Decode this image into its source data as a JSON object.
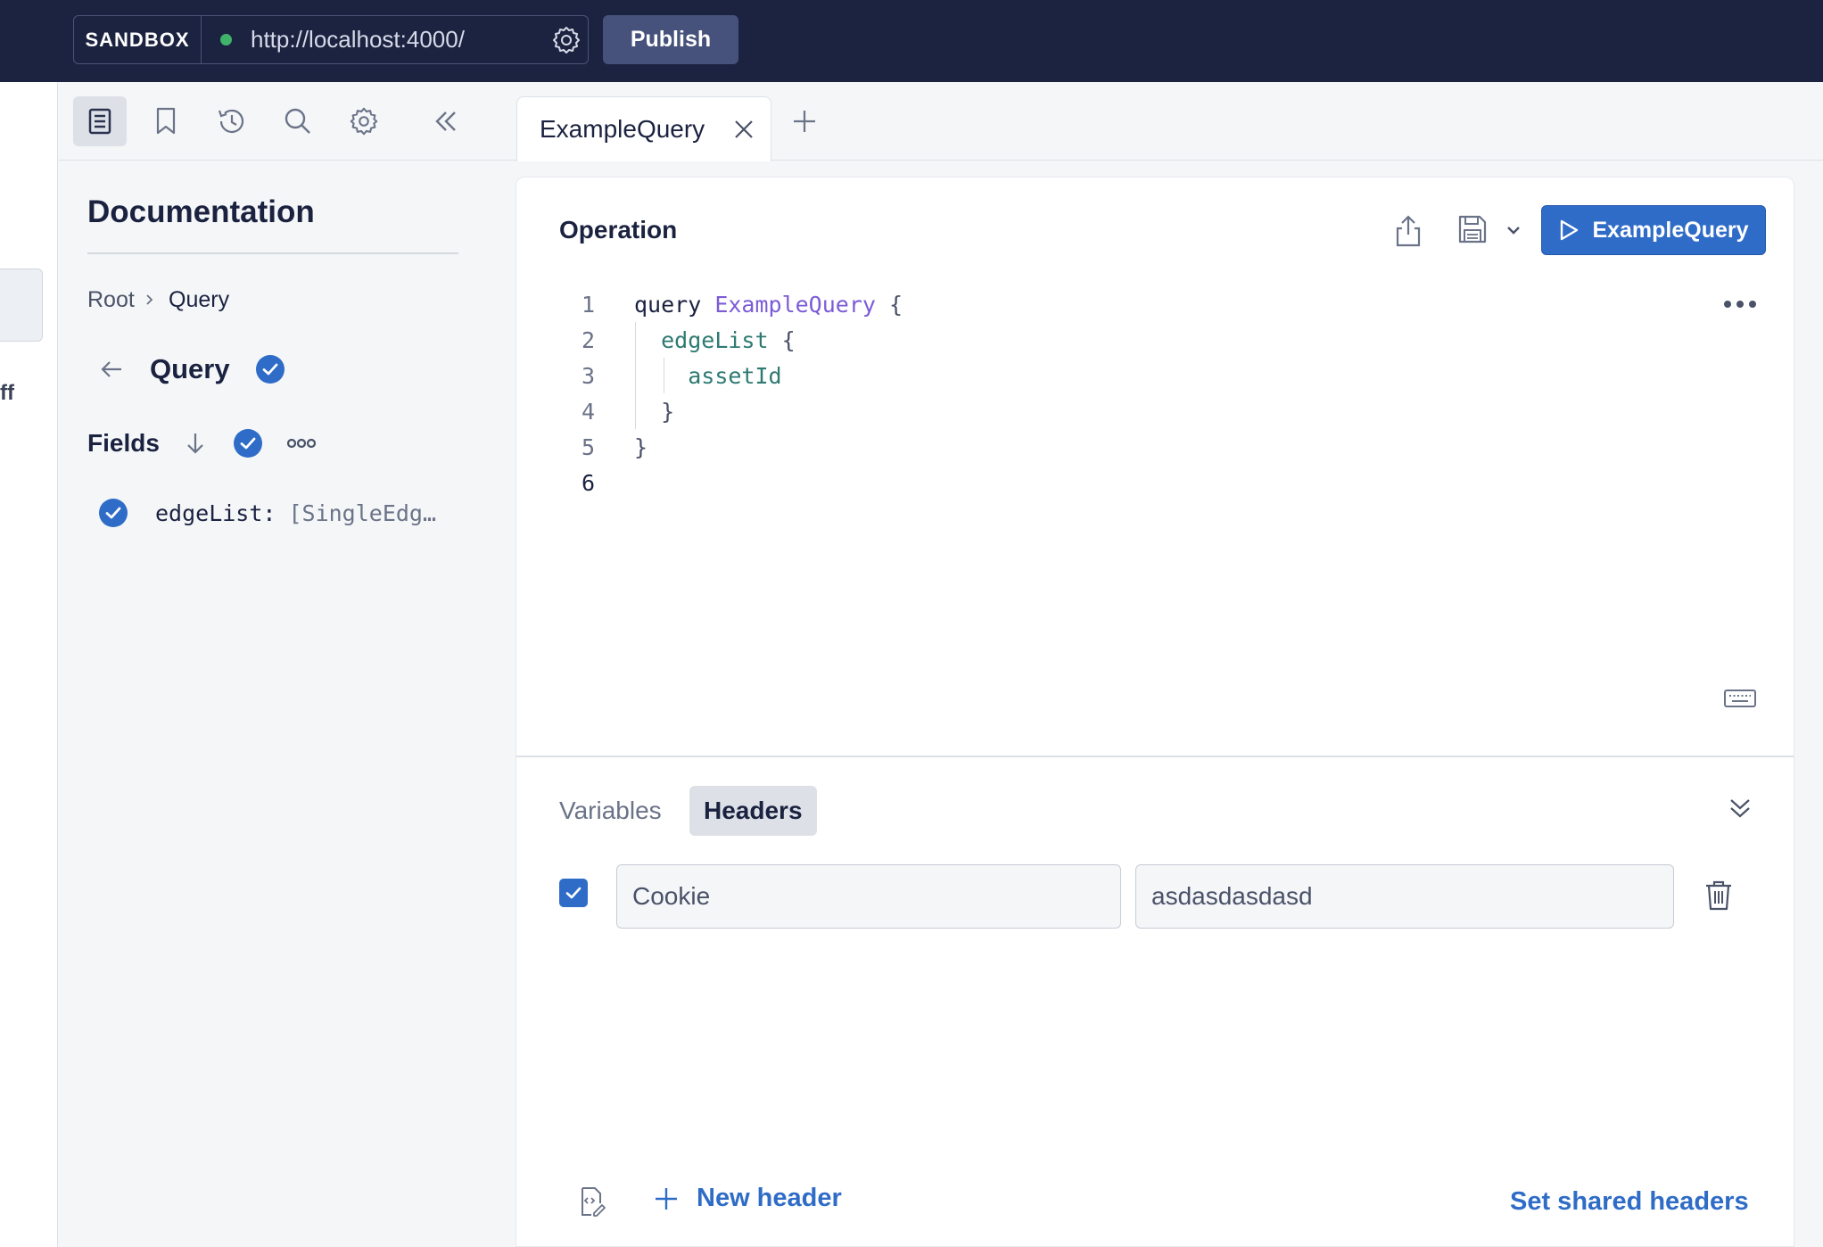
{
  "topbar": {
    "sandbox_label": "SANDBOX",
    "endpoint_url": "http://localhost:4000/",
    "status_color": "#3fb36a",
    "publish_label": "Publish"
  },
  "left_strip": {
    "partial_text": "ff"
  },
  "docs": {
    "title": "Documentation",
    "breadcrumb": [
      "Root",
      "Query"
    ],
    "type_name": "Query",
    "fields_title": "Fields",
    "fields": [
      {
        "name": "edgeList:",
        "type": "[SingleEdg…"
      }
    ]
  },
  "tabs": [
    {
      "label": "ExampleQuery"
    }
  ],
  "operation": {
    "title": "Operation",
    "run_label": "ExampleQuery",
    "line_numbers": [
      "1",
      "2",
      "3",
      "4",
      "5",
      "6"
    ],
    "code": {
      "l1_kw": "query",
      "l1_name": "ExampleQuery",
      "l1_brace": "{",
      "l2_field": "edgeList",
      "l2_brace": "{",
      "l3_field": "assetId",
      "l4_brace": "}",
      "l5_brace": "}"
    }
  },
  "bottom_pane": {
    "tabs": [
      "Variables",
      "Headers"
    ],
    "active_tab": "Headers",
    "headers": [
      {
        "enabled": true,
        "key": "Cookie",
        "value": "asdasdasdasd"
      }
    ],
    "new_header_label": "New header",
    "shared_headers_label": "Set shared headers"
  },
  "colors": {
    "topbar_bg": "#1c2340",
    "accent": "#2f6cc7",
    "publish_bg": "#46527c"
  }
}
